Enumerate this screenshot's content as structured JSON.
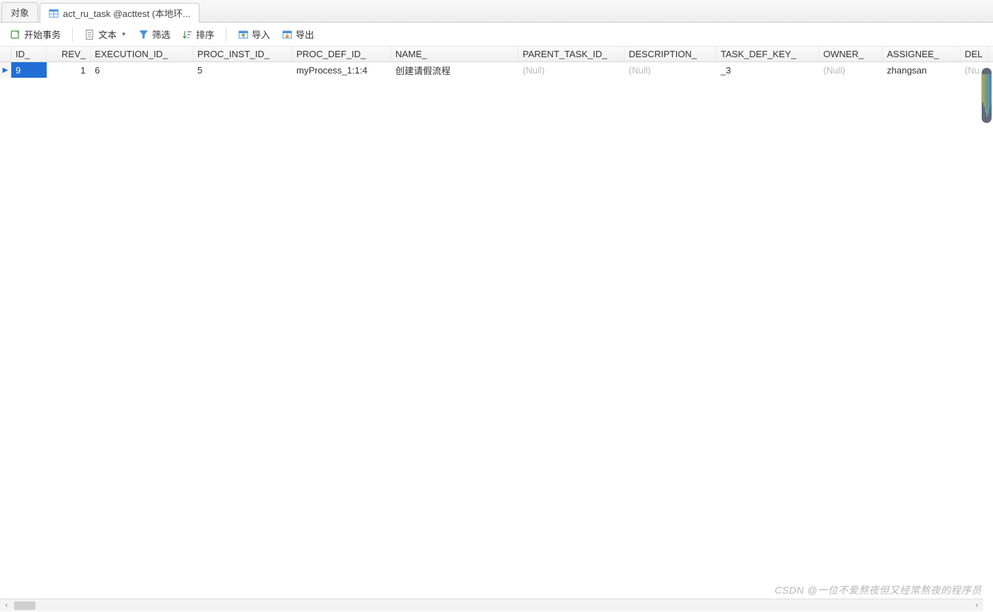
{
  "tabs": {
    "objects_label": "对象",
    "active_label": "act_ru_task @acttest (本地环..."
  },
  "toolbar": {
    "begin_tx": "开始事务",
    "text": "文本",
    "filter": "筛选",
    "sort": "排序",
    "import": "导入",
    "export": "导出"
  },
  "columns": {
    "id": "ID_",
    "rev": "REV_",
    "execution_id": "EXECUTION_ID_",
    "proc_inst_id": "PROC_INST_ID_",
    "proc_def_id": "PROC_DEF_ID_",
    "name": "NAME_",
    "parent_task_id": "PARENT_TASK_ID_",
    "description": "DESCRIPTION_",
    "task_def_key": "TASK_DEF_KEY_",
    "owner": "OWNER_",
    "assignee": "ASSIGNEE_",
    "del": "DEL"
  },
  "rows": [
    {
      "id": "9",
      "rev": "1",
      "execution_id": "6",
      "proc_inst_id": "5",
      "proc_def_id": "myProcess_1:1:4",
      "name": "创建请假流程",
      "parent_task_id": "(Null)",
      "description": "(Null)",
      "task_def_key": "_3",
      "owner": "(Null)",
      "assignee": "zhangsan",
      "del": "(Nu"
    }
  ],
  "watermark": "CSDN @一位不爱熬夜但又经常熬夜的程序员"
}
